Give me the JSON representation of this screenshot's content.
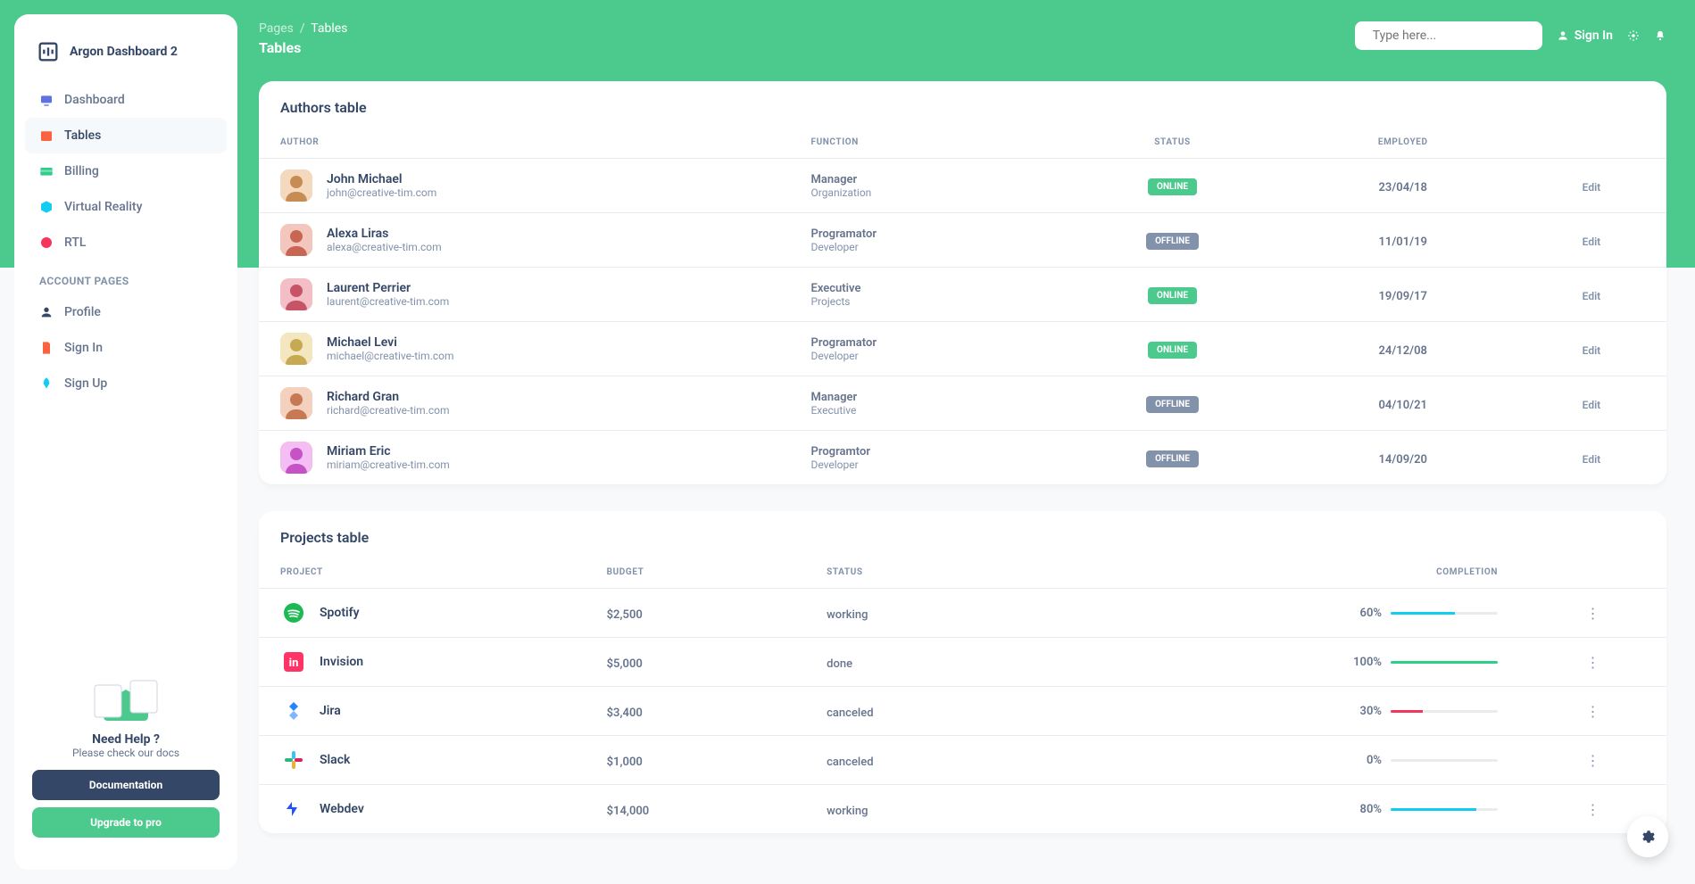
{
  "brand": "Argon Dashboard 2",
  "nav": {
    "items": [
      {
        "label": "Dashboard",
        "icon": "tv",
        "color": "#5e72e4"
      },
      {
        "label": "Tables",
        "icon": "calendar",
        "color": "#fb6340",
        "active": true
      },
      {
        "label": "Billing",
        "icon": "card",
        "color": "#2dce89"
      },
      {
        "label": "Virtual Reality",
        "icon": "box",
        "color": "#11cdef"
      },
      {
        "label": "RTL",
        "icon": "globe",
        "color": "#f5365c"
      }
    ],
    "account_heading": "ACCOUNT PAGES",
    "account_items": [
      {
        "label": "Profile",
        "icon": "user",
        "color": "#344767"
      },
      {
        "label": "Sign In",
        "icon": "doc",
        "color": "#fb6340"
      },
      {
        "label": "Sign Up",
        "icon": "rocket",
        "color": "#11cdef"
      }
    ]
  },
  "help": {
    "title": "Need Help ?",
    "subtitle": "Please check our docs",
    "btn1": "Documentation",
    "btn2": "Upgrade to pro"
  },
  "breadcrumb": {
    "root": "Pages",
    "page": "Tables"
  },
  "page_title": "Tables",
  "search": {
    "placeholder": "Type here..."
  },
  "topbar": {
    "signin": "Sign In"
  },
  "authors": {
    "title": "Authors table",
    "headers": {
      "author": "AUTHOR",
      "function": "FUNCTION",
      "status": "STATUS",
      "employed": "EMPLOYED"
    },
    "edit_label": "Edit",
    "rows": [
      {
        "name": "John Michael",
        "email": "john@creative-tim.com",
        "role": "Manager",
        "dept": "Organization",
        "status": "ONLINE",
        "date": "23/04/18",
        "hue": 30
      },
      {
        "name": "Alexa Liras",
        "email": "alexa@creative-tim.com",
        "role": "Programator",
        "dept": "Developer",
        "status": "OFFLINE",
        "date": "11/01/19",
        "hue": 10
      },
      {
        "name": "Laurent Perrier",
        "email": "laurent@creative-tim.com",
        "role": "Executive",
        "dept": "Projects",
        "status": "ONLINE",
        "date": "19/09/17",
        "hue": 350
      },
      {
        "name": "Michael Levi",
        "email": "michael@creative-tim.com",
        "role": "Programator",
        "dept": "Developer",
        "status": "ONLINE",
        "date": "24/12/08",
        "hue": 45
      },
      {
        "name": "Richard Gran",
        "email": "richard@creative-tim.com",
        "role": "Manager",
        "dept": "Executive",
        "status": "OFFLINE",
        "date": "04/10/21",
        "hue": 20
      },
      {
        "name": "Miriam Eric",
        "email": "miriam@creative-tim.com",
        "role": "Programtor",
        "dept": "Developer",
        "status": "OFFLINE",
        "date": "14/09/20",
        "hue": 300
      }
    ]
  },
  "projects": {
    "title": "Projects table",
    "headers": {
      "project": "PROJECT",
      "budget": "BUDGET",
      "status": "STATUS",
      "completion": "COMPLETION"
    },
    "rows": [
      {
        "name": "Spotify",
        "icon": "spotify",
        "color": "#1DB954",
        "budget": "$2,500",
        "status": "working",
        "pct": 60,
        "bar": "#11cdef"
      },
      {
        "name": "Invision",
        "icon": "invision",
        "color": "#ff3366",
        "budget": "$5,000",
        "status": "done",
        "pct": 100,
        "bar": "#2dce89"
      },
      {
        "name": "Jira",
        "icon": "jira",
        "color": "#2684ff",
        "budget": "$3,400",
        "status": "canceled",
        "pct": 30,
        "bar": "#f5365c"
      },
      {
        "name": "Slack",
        "icon": "slack",
        "color": "#4A154B",
        "budget": "$1,000",
        "status": "canceled",
        "pct": 0,
        "bar": "#8392ab"
      },
      {
        "name": "Webdev",
        "icon": "webdev",
        "color": "#2152ff",
        "budget": "$14,000",
        "status": "working",
        "pct": 80,
        "bar": "#11cdef"
      }
    ]
  }
}
